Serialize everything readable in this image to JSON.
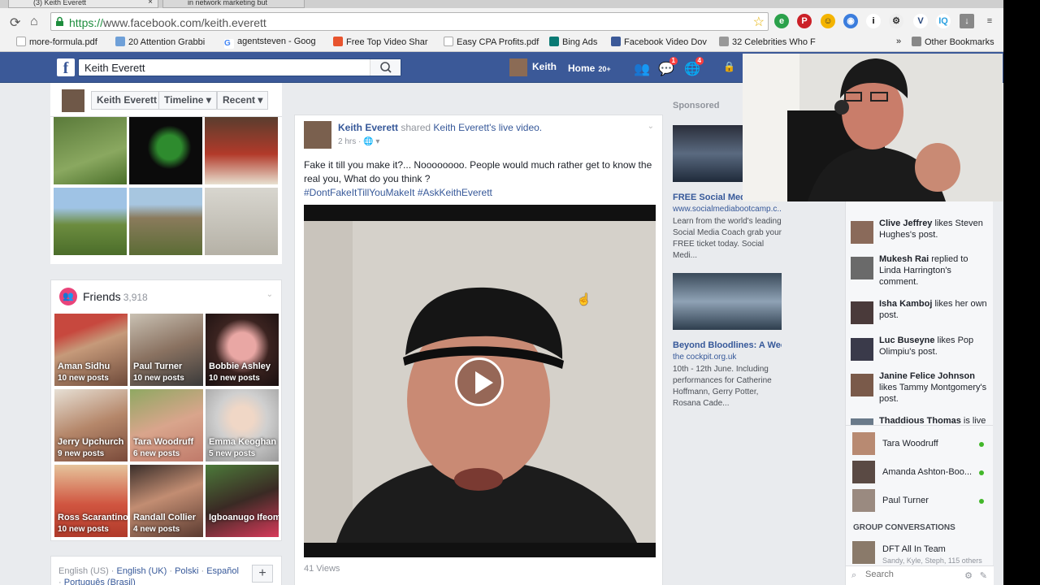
{
  "browser": {
    "tabs": [
      {
        "label": "(3) Keith Everett"
      },
      {
        "label": "in network marketing but"
      }
    ],
    "url_scheme": "https://",
    "url_rest": "www.facebook.com/keith.everett",
    "bookmarks": [
      "more-formula.pdf",
      "20 Attention Grabbi",
      "agentsteven - Goog",
      "Free Top Video Shar",
      "Easy CPA Profits.pdf",
      "Bing Ads",
      "Facebook Video Dov",
      "32 Celebrities Who F",
      "Other Bookmarks"
    ],
    "more_bookmarks": "»"
  },
  "fb": {
    "search_value": "Keith Everett",
    "nav_user": "Keith",
    "nav_home": "Home",
    "nav_home_count": "20+",
    "badges": {
      "messages": "1",
      "notifications": "4"
    },
    "profile_buttons": [
      "Keith Everett",
      "Timeline",
      "Recent"
    ],
    "friends": {
      "title": "Friends",
      "count": "3,918",
      "list": [
        {
          "name": "Aman Sidhu",
          "posts": "10 new posts"
        },
        {
          "name": "Paul Turner",
          "posts": "10 new posts"
        },
        {
          "name": "Bobbie Ashley",
          "posts": "10 new posts"
        },
        {
          "name": "Jerry Upchurch",
          "posts": "9 new posts"
        },
        {
          "name": "Tara Woodruff",
          "posts": "6 new posts"
        },
        {
          "name": "Emma Keoghan",
          "posts": "5 new posts"
        },
        {
          "name": "Ross Scarantino",
          "posts": "10 new posts"
        },
        {
          "name": "Randall Collier",
          "posts": "4 new posts"
        },
        {
          "name": "Igboanugo Ifeoma Peace",
          "posts": ""
        }
      ]
    },
    "languages": {
      "current": "English (US)",
      "others": [
        "English (UK)",
        "Polski",
        "Español",
        "Português (Brasil)"
      ],
      "plus": "+"
    },
    "post": {
      "author": "Keith Everett",
      "shared": "shared",
      "target": "Keith Everett",
      "target_suffix": "'s",
      "target_type": "live video.",
      "time": "2 hrs",
      "text": "Fake it till you make it?... Noooooooo. People would much rather get to know the real you, What do you think ?",
      "hashtags": "#DontFakeItTillYouMakeIt #AskKeithEverett",
      "views": "41 Views"
    },
    "sponsored": {
      "heading": "Sponsored",
      "ads": [
        {
          "title": "FREE Social Media",
          "url": "www.socialmediabootcamp.c...",
          "desc": "Learn from the world's leading Social Media Coach grab your FREE ticket today. Social Medi..."
        },
        {
          "title": "Beyond Bloodlines: A Wee...",
          "url": "the cockpit.org.uk",
          "desc": "10th - 12th June. Including performances for Catherine Hoffmann, Gerry Potter, Rosana Cade..."
        }
      ]
    },
    "ticker": [
      {
        "name": "Clive Jeffrey",
        "text": "likes Steven Hughes's post."
      },
      {
        "name": "Mukesh Rai",
        "text": "replied to Linda Harrington's comment."
      },
      {
        "name": "Isha Kamboj",
        "text": "likes her own post."
      },
      {
        "name": "Luc Buseyne",
        "text": "likes Pop Olimpiu's post."
      },
      {
        "name": "Janine Felice Johnson",
        "text": "likes Tammy Montgomery's post."
      },
      {
        "name": "Thaddious Thomas",
        "text": "is live"
      }
    ],
    "chat": {
      "contacts": [
        "Tara Woodruff",
        "Amanda Ashton-Boo...",
        "Paul Turner"
      ],
      "group_heading": "GROUP CONVERSATIONS",
      "group_name": "DFT All In Team",
      "group_members": "Sandy, Kyle, Steph, 115 others",
      "search_placeholder": "Search"
    }
  }
}
